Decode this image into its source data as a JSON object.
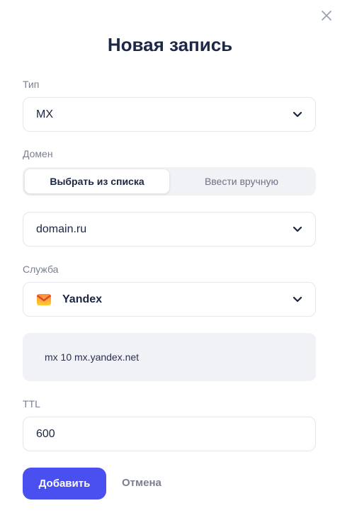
{
  "dialog": {
    "title": "Новая запись"
  },
  "type_field": {
    "label": "Тип",
    "value": "MX"
  },
  "domain_field": {
    "label": "Домен",
    "modes": [
      "Выбрать из списка",
      "Ввести вручную"
    ],
    "active_mode": "Выбрать из списка",
    "value": "domain.ru"
  },
  "service_field": {
    "label": "Служба",
    "value": "Yandex",
    "icon": "yandex-mail-icon"
  },
  "record_preview": {
    "text": "mx 10 mx.yandex.net"
  },
  "ttl_field": {
    "label": "TTL",
    "value": "600"
  },
  "actions": {
    "submit": "Добавить",
    "cancel": "Отмена"
  },
  "colors": {
    "primary": "#4a4ff0",
    "title": "#1d2748",
    "muted": "#7a7f90",
    "border": "#e4e6ec",
    "panel": "#f1f2f5"
  }
}
